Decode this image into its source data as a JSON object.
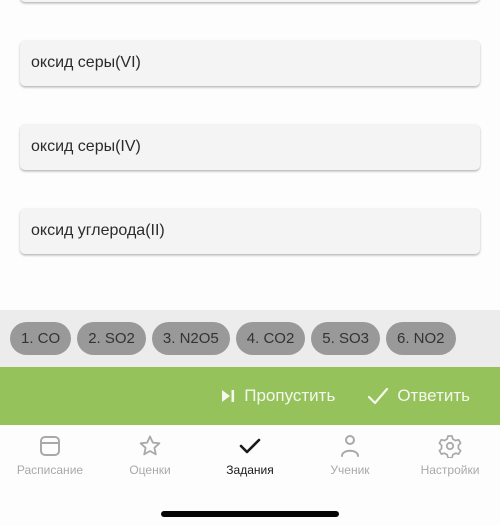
{
  "answer_options": [
    {
      "label": ""
    },
    {
      "label": "оксид серы(VI)"
    },
    {
      "label": "оксид серы(IV)"
    },
    {
      "label": "оксид углерода(II)"
    }
  ],
  "formula_chips": [
    {
      "label": "1. CO"
    },
    {
      "label": "2. SO2"
    },
    {
      "label": "3. N2O5"
    },
    {
      "label": "4. CO2"
    },
    {
      "label": "5. SO3"
    },
    {
      "label": "6. NO2"
    }
  ],
  "actions": {
    "skip": {
      "label": "Пропустить",
      "icon": "skip-next-icon"
    },
    "answer": {
      "label": "Ответить",
      "icon": "check-icon"
    }
  },
  "tabbar": {
    "items": [
      {
        "label": "Расписание",
        "icon": "calendar-icon",
        "active": false
      },
      {
        "label": "Оценки",
        "icon": "star-icon",
        "active": false
      },
      {
        "label": "Задания",
        "icon": "check-icon",
        "active": true
      },
      {
        "label": "Ученик",
        "icon": "person-icon",
        "active": false
      },
      {
        "label": "Настройки",
        "icon": "gear-icon",
        "active": false
      }
    ]
  },
  "colors": {
    "accent_green": "#95c25b",
    "chip_bg": "#999999",
    "tab_inactive": "#a9a9a9",
    "tab_active": "#1a1a1a"
  }
}
